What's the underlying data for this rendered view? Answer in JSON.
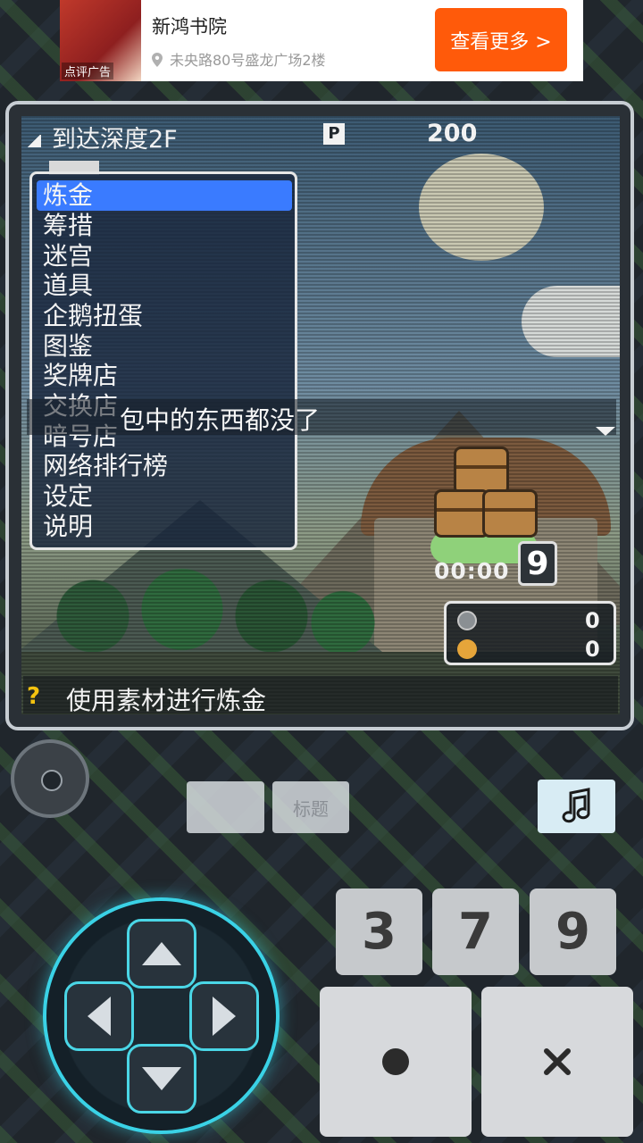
{
  "ad": {
    "thumb_tag": "点评广告",
    "title": "新鸿书院",
    "address": "未央路80号盛龙广场2楼",
    "button": "查看更多 >"
  },
  "hud": {
    "depth": "到达深度2F",
    "points_icon": "P",
    "points": "200"
  },
  "menu": {
    "items": [
      "炼金",
      "筹措",
      "迷宫",
      "道具",
      "企鹅扭蛋",
      "图鉴",
      "奖牌店",
      "交换店",
      "暗号店",
      "网络排行榜",
      "设定",
      "说明"
    ],
    "selected": "炼金"
  },
  "message": "包中的东西都没了",
  "timer": "00:00",
  "chest_count": "9",
  "resources": {
    "gear": "0",
    "coin": "0"
  },
  "status": {
    "help": "?",
    "text": "使用素材进行炼金"
  },
  "controls": {
    "soft_left": "",
    "soft_title": "标题",
    "music_icon": "music-note-icon",
    "num_keys": [
      "3",
      "7",
      "9"
    ],
    "circle_icon": "circle-icon",
    "cross_icon": "cross-icon",
    "dpad_icons": [
      "up-arrow-icon",
      "left-arrow-icon",
      "right-arrow-icon",
      "down-arrow-icon"
    ]
  },
  "colors": {
    "selection": "#3a7bff",
    "ad_button": "#ff5a0a",
    "dpad_glow": "#3ad2e6"
  }
}
